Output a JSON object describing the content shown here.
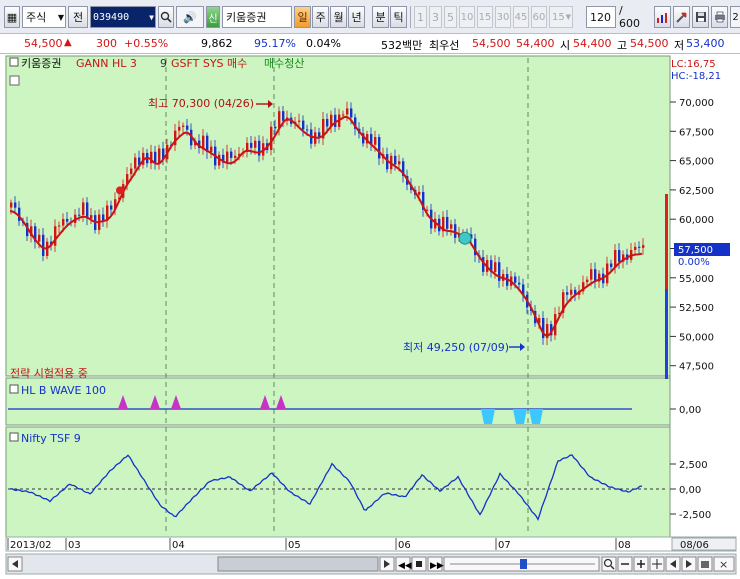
{
  "window": {
    "close_glyph": "×"
  },
  "toolbar": {
    "market_type": "주식",
    "market_label": "전",
    "stock_code": "039490",
    "shin_badge": "신",
    "stock_name": "키움증권",
    "recent_btn": "일",
    "periods": [
      "주",
      "월",
      "년",
      "분",
      "틱"
    ],
    "intervals": [
      "1",
      "3",
      "5",
      "10",
      "15",
      "30",
      "45",
      "60",
      "15"
    ],
    "count": "120",
    "total": "/ 600",
    "right_badge": "2"
  },
  "quote": {
    "price": "54,500",
    "change_arrow": "▲",
    "change": "300",
    "change_pct": "+0.55%",
    "volume": "9,862",
    "vol_ratio": "95.17%",
    "turnover": "0.04%",
    "amount": "532백만",
    "bid_label": "최우선",
    "bid": "54,500",
    "ask": "54,400",
    "open_label": "시",
    "open": "54,400",
    "high_label": "고",
    "high": "54,500",
    "low_label": "저",
    "low": "53,400"
  },
  "price_pane": {
    "legend": [
      "키움증권",
      "GANN HL 3",
      "9",
      "GSFT SYS 매수",
      "매수청산"
    ],
    "lc_label": "LC:16,75",
    "hc_label": "HC:-18,21",
    "strategy_note": "전략 시험적용 중",
    "high_annotation": "최고 70,300 (04/26)",
    "low_annotation": "최저 49,250 (07/09)",
    "current_price_label": "57,500",
    "current_pct_label": "0.00%",
    "y_ticks": [
      "70,000",
      "67,500",
      "65,000",
      "62,500",
      "60,000",
      "57,500",
      "55,000",
      "52,500",
      "50,000",
      "47,500"
    ]
  },
  "wave_pane": {
    "title": "HL B WAVE 100",
    "y_ticks": [
      "0,00"
    ]
  },
  "tsf_pane": {
    "title": "Nifty TSF 9",
    "y_ticks": [
      "2,500",
      "0,00",
      "-2,500"
    ]
  },
  "x_axis": {
    "labels": [
      "2013/02",
      "03",
      "04",
      "05",
      "06",
      "07",
      "08"
    ],
    "right_label": "08/06"
  },
  "colors": {
    "chart_bg": "#ccf5c2",
    "up": "#d21414",
    "down": "#1432c8",
    "signal_line": "#c81414",
    "cyan_marker": "#40c8c8",
    "buy_marker": "#c832c8",
    "sell_marker": "#3cc8ff"
  },
  "chart_data": {
    "type": "line",
    "price_points": [
      [
        0,
        61000
      ],
      [
        8,
        60300
      ],
      [
        16,
        59200
      ],
      [
        24,
        58200
      ],
      [
        32,
        57600
      ],
      [
        40,
        58400
      ],
      [
        48,
        59300
      ],
      [
        56,
        60000
      ],
      [
        64,
        60400
      ],
      [
        72,
        60600
      ],
      [
        80,
        60000
      ],
      [
        88,
        60100
      ],
      [
        96,
        60300
      ],
      [
        104,
        61600
      ],
      [
        112,
        63200
      ],
      [
        118,
        63800
      ],
      [
        126,
        65000
      ],
      [
        134,
        65800
      ],
      [
        142,
        64800
      ],
      [
        150,
        65400
      ],
      [
        158,
        66700
      ],
      [
        166,
        67400
      ],
      [
        174,
        67900
      ],
      [
        182,
        66700
      ],
      [
        190,
        66300
      ],
      [
        198,
        65900
      ],
      [
        206,
        65400
      ],
      [
        214,
        65000
      ],
      [
        222,
        65200
      ],
      [
        230,
        66200
      ],
      [
        238,
        66100
      ],
      [
        246,
        65900
      ],
      [
        254,
        66500
      ],
      [
        262,
        67500
      ],
      [
        268,
        68500
      ],
      [
        274,
        69000
      ],
      [
        282,
        68400
      ],
      [
        290,
        67700
      ],
      [
        298,
        67300
      ],
      [
        306,
        67200
      ],
      [
        312,
        67600
      ],
      [
        318,
        68400
      ],
      [
        326,
        68800
      ],
      [
        334,
        69200
      ],
      [
        342,
        68100
      ],
      [
        350,
        67300
      ],
      [
        358,
        66600
      ],
      [
        366,
        66000
      ],
      [
        374,
        65200
      ],
      [
        382,
        64800
      ],
      [
        390,
        64200
      ],
      [
        398,
        63000
      ],
      [
        406,
        62000
      ],
      [
        414,
        60500
      ],
      [
        422,
        60000
      ],
      [
        430,
        59300
      ],
      [
        438,
        59300
      ],
      [
        446,
        59000
      ],
      [
        454,
        58700
      ],
      [
        462,
        57500
      ],
      [
        470,
        56500
      ],
      [
        478,
        55800
      ],
      [
        486,
        55300
      ],
      [
        494,
        55200
      ],
      [
        500,
        54800
      ],
      [
        508,
        54000
      ],
      [
        516,
        53000
      ],
      [
        524,
        51500
      ],
      [
        532,
        50000
      ],
      [
        540,
        51000
      ],
      [
        548,
        52500
      ],
      [
        556,
        53500
      ],
      [
        564,
        54000
      ],
      [
        572,
        54500
      ],
      [
        580,
        55000
      ],
      [
        588,
        55200
      ],
      [
        596,
        55700
      ],
      [
        604,
        56500
      ],
      [
        612,
        57000
      ],
      [
        620,
        57300
      ],
      [
        628,
        57300
      ],
      [
        632,
        57500
      ]
    ],
    "tsf_points": [
      [
        0,
        0
      ],
      [
        20,
        -300
      ],
      [
        40,
        -1200
      ],
      [
        60,
        500
      ],
      [
        80,
        -500
      ],
      [
        100,
        1800
      ],
      [
        118,
        3400
      ],
      [
        130,
        1500
      ],
      [
        150,
        -1600
      ],
      [
        165,
        -2800
      ],
      [
        180,
        -1200
      ],
      [
        200,
        800
      ],
      [
        220,
        1200
      ],
      [
        240,
        -200
      ],
      [
        262,
        1600
      ],
      [
        280,
        -300
      ],
      [
        300,
        -1500
      ],
      [
        322,
        2500
      ],
      [
        340,
        700
      ],
      [
        355,
        -2200
      ],
      [
        375,
        -400
      ],
      [
        395,
        -800
      ],
      [
        412,
        1400
      ],
      [
        430,
        -200
      ],
      [
        448,
        1200
      ],
      [
        470,
        -2600
      ],
      [
        490,
        1500
      ],
      [
        508,
        -400
      ],
      [
        528,
        -3000
      ],
      [
        548,
        2800
      ],
      [
        562,
        3400
      ],
      [
        580,
        1200
      ],
      [
        600,
        200
      ],
      [
        618,
        -300
      ],
      [
        632,
        300
      ]
    ],
    "buy_markers_x": [
      113,
      145,
      166,
      255,
      271
    ],
    "sell_markers_x": [
      478,
      510,
      526
    ]
  }
}
